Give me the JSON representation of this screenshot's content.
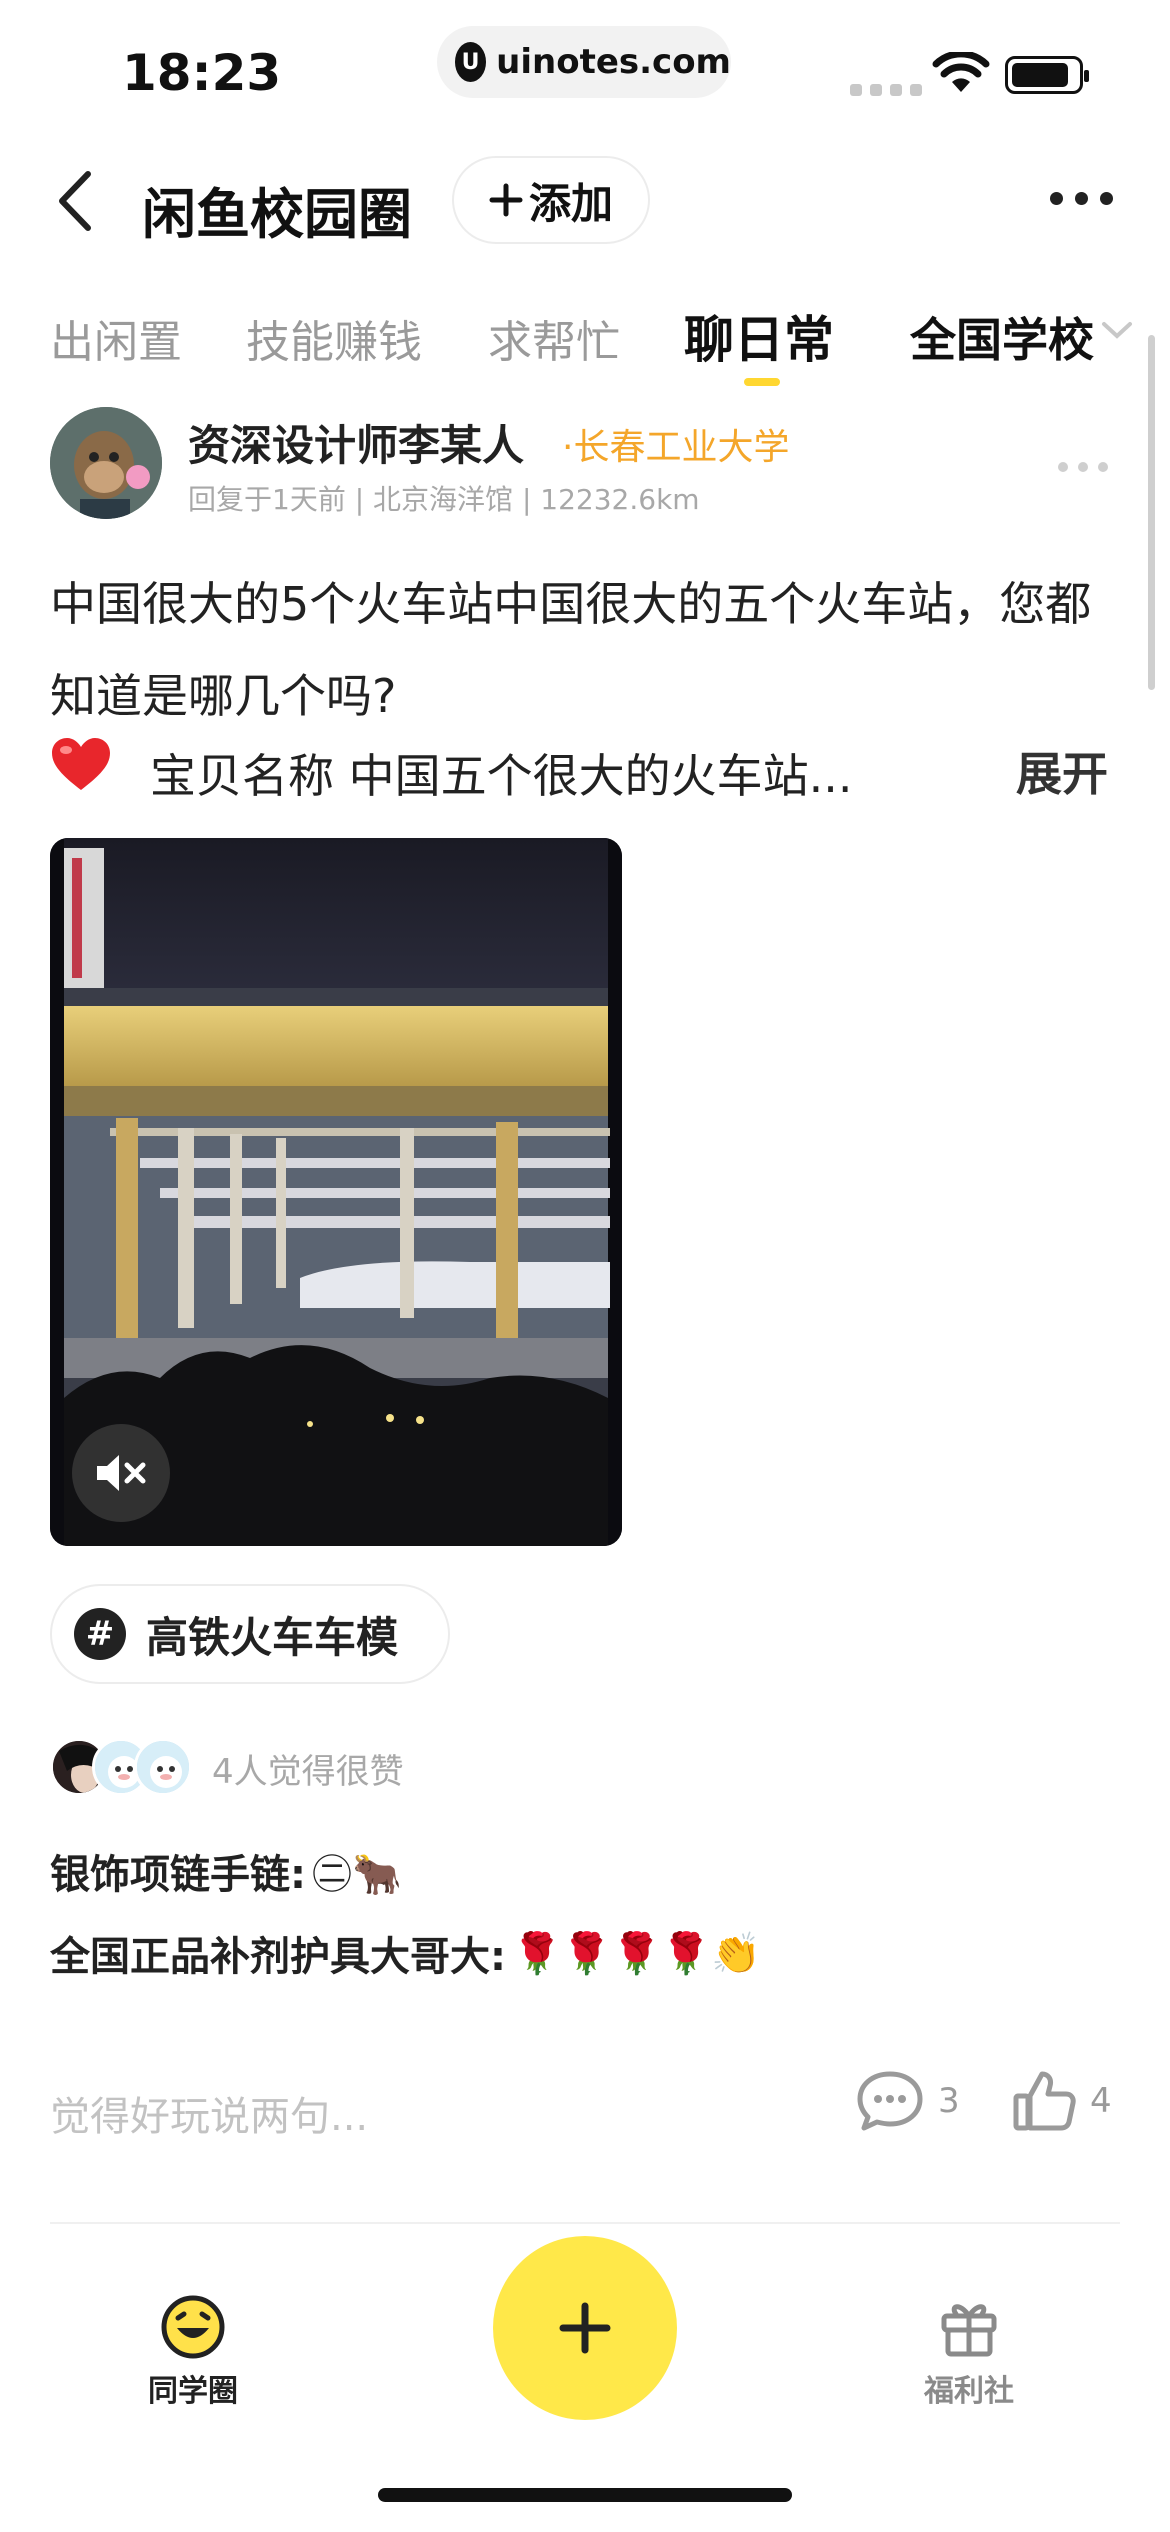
{
  "status_bar": {
    "time": "18:23",
    "url": "uinotes.com",
    "url_logo": "U"
  },
  "header": {
    "title": "闲鱼校园圈",
    "add_label": "添加"
  },
  "tabs": [
    {
      "label": "出闲置"
    },
    {
      "label": "技能赚钱"
    },
    {
      "label": "求帮忙"
    },
    {
      "label": "聊日常",
      "active": true
    },
    {
      "label": "全国学校"
    }
  ],
  "post": {
    "username": "资深设计师李某人",
    "school": "·长春工业大学",
    "meta": "回复于1天前 | 北京海洋馆 | 12232.6km",
    "text": "中国很大的5个火车站中国很大的五个火车站，您都知道是哪几个吗?",
    "product_text": "宝贝名称  中国五个很大的火车站...",
    "expand_label": "展开",
    "topic": "高铁火车车模",
    "topic_symbol": "#",
    "likes_text": "4人觉得很赞",
    "comments": [
      {
        "label": "银饰项链手链:",
        "emoji": "㊁🐂"
      },
      {
        "label": "全国正品补剂护具大哥大:",
        "emoji": "🌹🌹🌹🌹👏"
      }
    ],
    "comment_placeholder": "觉得好玩说两句...",
    "comment_count": "3",
    "like_count": "4"
  },
  "bottom_nav": {
    "left_label": "同学圈",
    "right_label": "福利社"
  },
  "colors": {
    "accent_yellow": "#ffe849",
    "tab_indicator": "#ffd731",
    "school_orange": "#f4a62a",
    "muted_gray": "#a8a8a8"
  }
}
